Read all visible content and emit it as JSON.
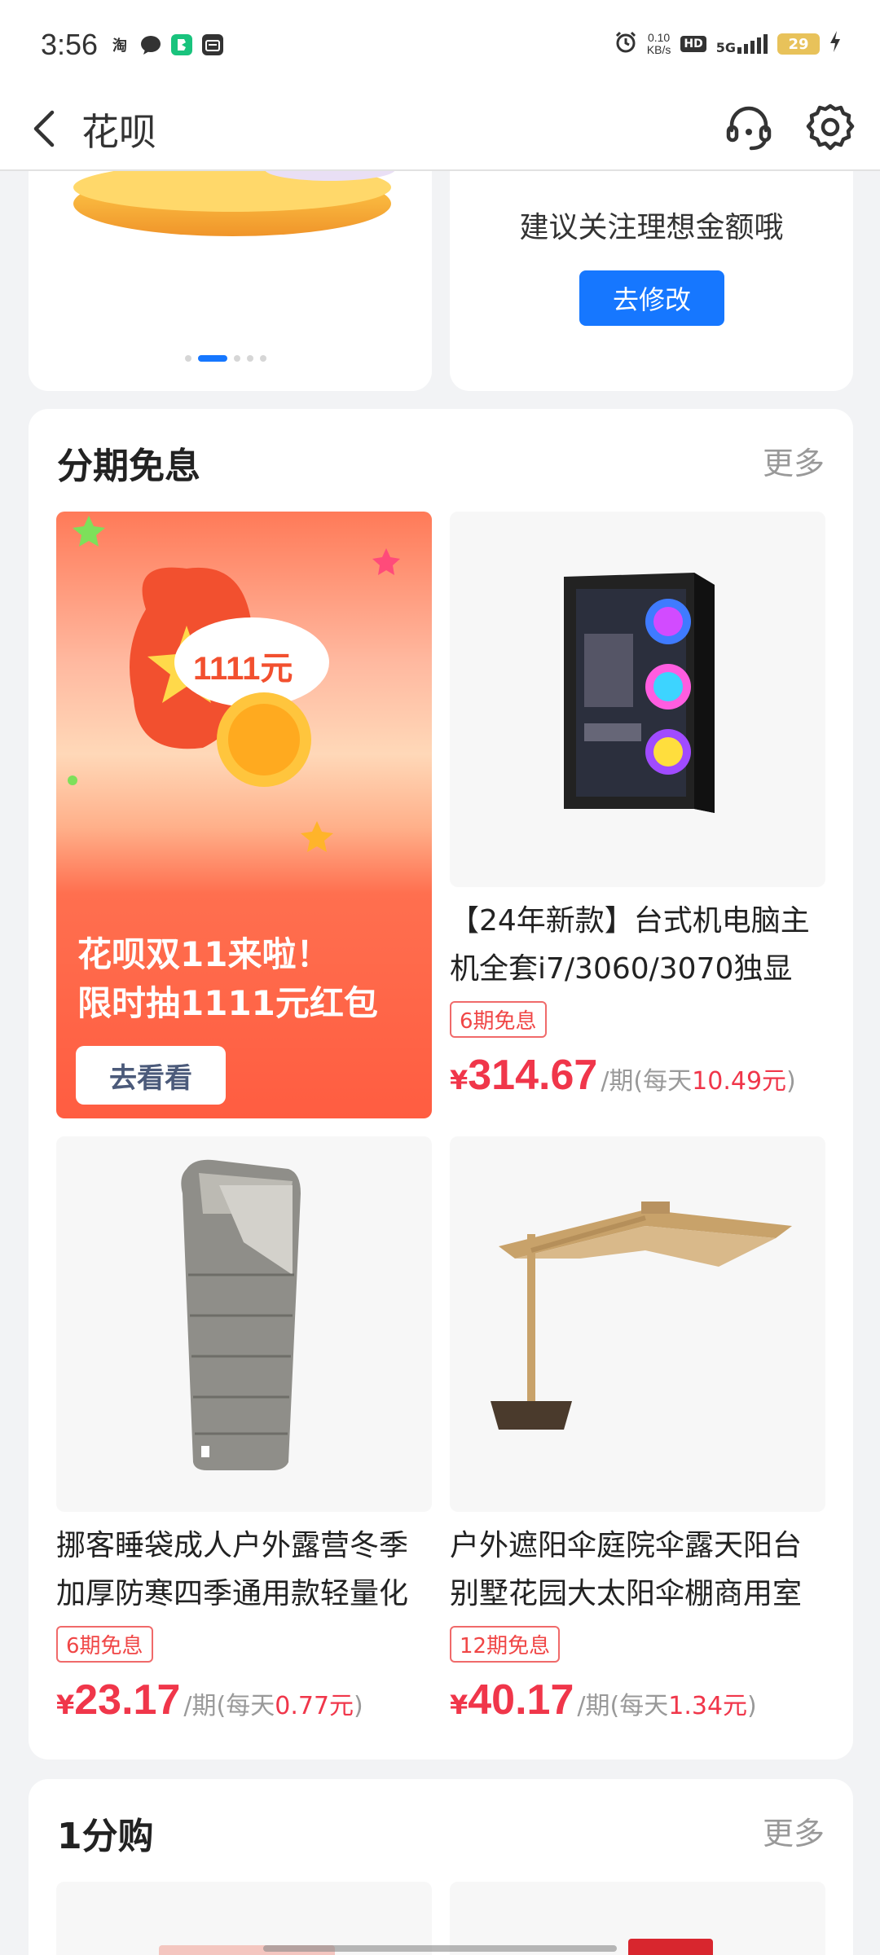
{
  "status_bar": {
    "time": "3:56",
    "notif_icons": [
      "taobao-icon",
      "chat-bubble-icon",
      "green-app-icon",
      "wallet-icon"
    ],
    "taobao_glyph": "淘",
    "net_speed_value": "0.10",
    "net_speed_unit": "KB/s",
    "hd": "HD",
    "net_type": "5G",
    "battery": "29"
  },
  "header": {
    "title": "花呗"
  },
  "top_cards": {
    "right_text": "建议关注理想金额哦",
    "right_button": "去修改",
    "carousel_count": 5,
    "carousel_active": 2
  },
  "installment_section": {
    "title": "分期免息",
    "more": "更多",
    "banner": {
      "bubble": "1111元",
      "line1": "花呗双11来啦！",
      "line2": "限时抽1111元红包",
      "button": "去看看"
    },
    "products": [
      {
        "title": "【24年新款】台式机电脑主机全套i7/3060/3070独显",
        "tag": "6期免息",
        "yen": "¥",
        "price": "314.67",
        "unit": "/期",
        "daily_prefix": "(每天",
        "daily_value": "10.49元",
        "daily_suffix": ")",
        "icon": "pc-case-icon"
      },
      {
        "title": "挪客睡袋成人户外露营冬季加厚防寒四季通用款轻量化",
        "tag": "6期免息",
        "yen": "¥",
        "price": "23.17",
        "unit": "/期",
        "daily_prefix": "(每天",
        "daily_value": "0.77元",
        "daily_suffix": ")",
        "icon": "sleeping-bag-icon"
      },
      {
        "title": "户外遮阳伞庭院伞露天阳台别墅花园大太阳伞棚商用室",
        "tag": "12期免息",
        "yen": "¥",
        "price": "40.17",
        "unit": "/期",
        "daily_prefix": "(每天",
        "daily_value": "1.34元",
        "daily_suffix": ")",
        "icon": "umbrella-icon"
      }
    ]
  },
  "one_cent_section": {
    "title": "1分购",
    "more": "更多"
  },
  "colors": {
    "accent": "#1677ff",
    "price": "#f0364a",
    "background": "#f2f3f5"
  }
}
